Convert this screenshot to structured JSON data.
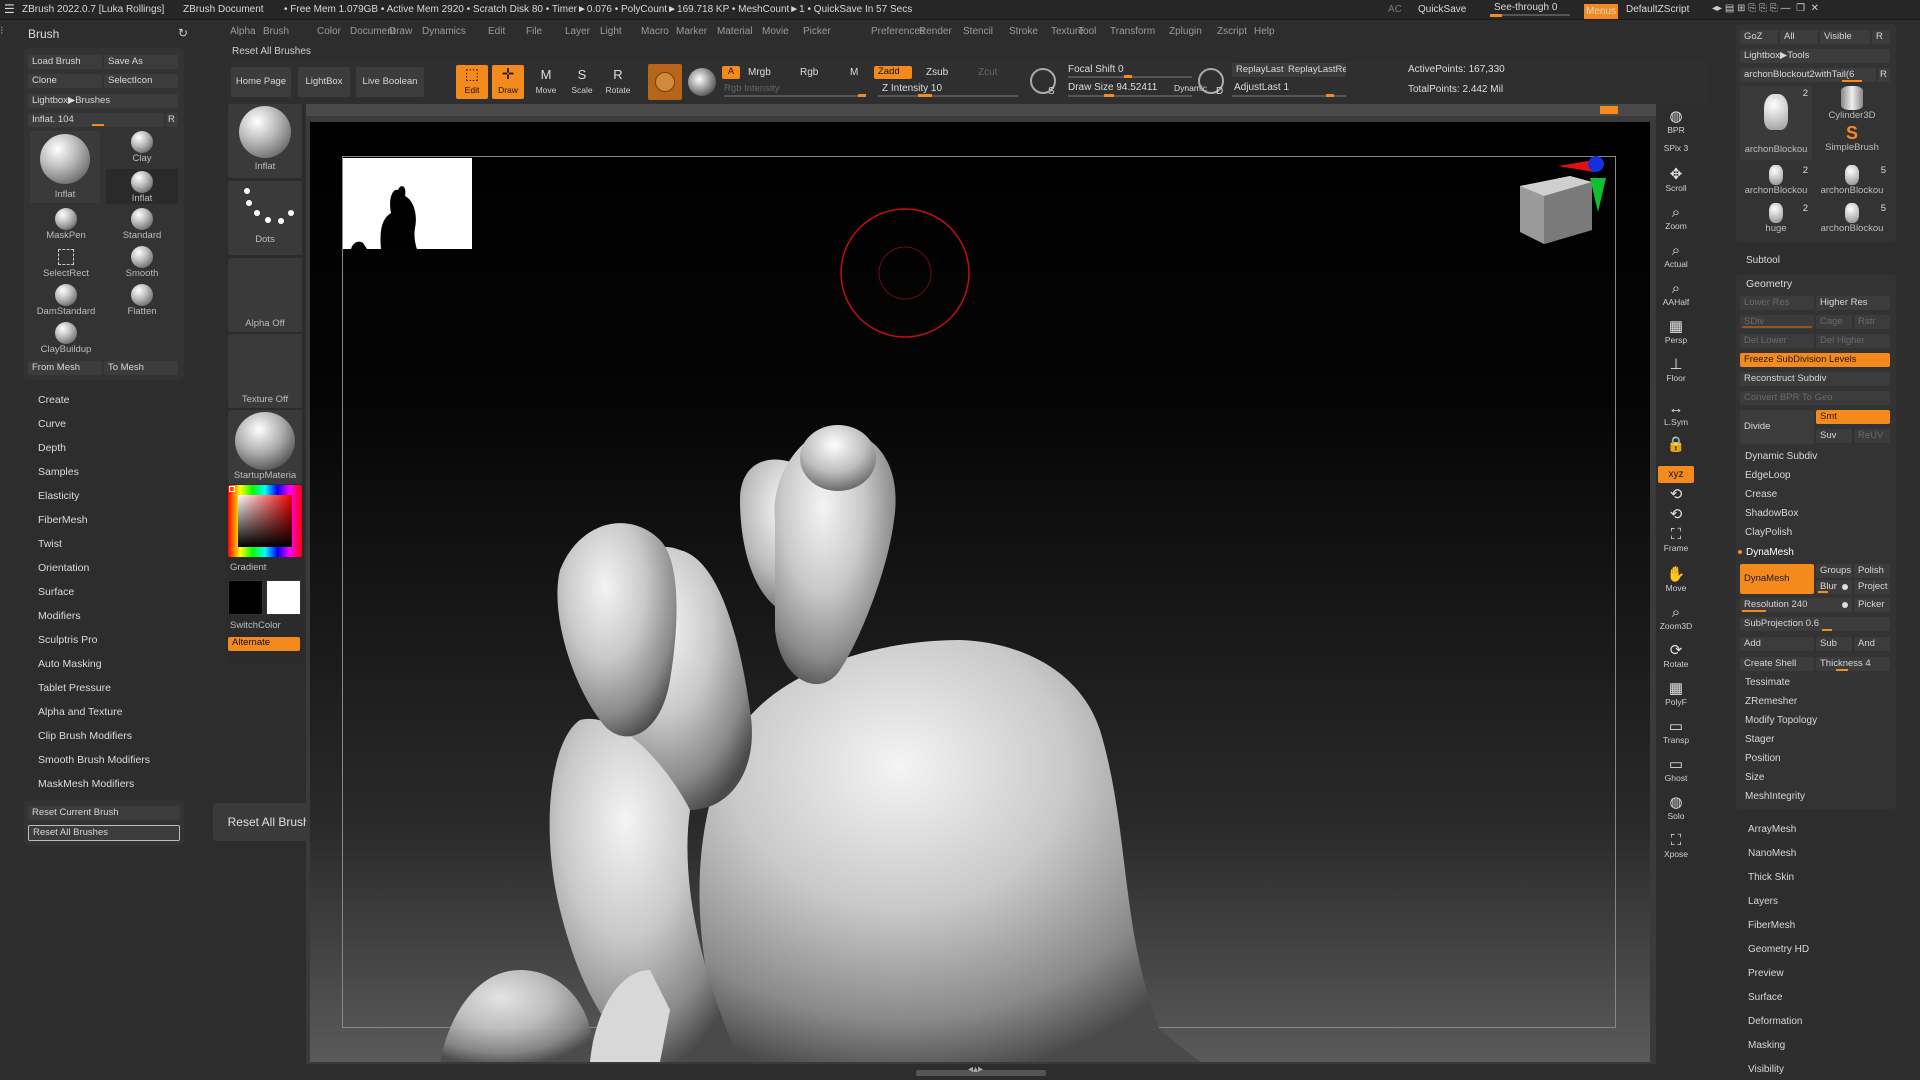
{
  "titlebar": {
    "app": "ZBrush 2022.0.7 [Luka Rollings]",
    "doc": "ZBrush Document",
    "stats": "• Free Mem 1.079GB • Active Mem 2920 • Scratch Disk 80 • Timer►0.076 • PolyCount►169.718 KP • MeshCount►1 • QuickSave In 57 Secs",
    "ac": "AC",
    "quicksave": "QuickSave",
    "seethrough": "See-through 0",
    "menus": "Menus",
    "script": "DefaultZScript"
  },
  "menubar": [
    "Alpha",
    "Brush",
    "Color",
    "Document",
    "Draw",
    "Dynamics",
    "Edit",
    "File",
    "Layer",
    "Light",
    "Macro",
    "Marker",
    "Material",
    "Movie",
    "Picker",
    "Preferences",
    "Render",
    "Stencil",
    "Stroke",
    "Texture",
    "Tool",
    "Transform",
    "Zplugin",
    "Zscript",
    "Help"
  ],
  "tooltip_top": "Reset All Brushes",
  "toolbar": {
    "home": "Home Page",
    "lightbox": "LightBox",
    "liveboolean": "Live Boolean",
    "edit": "Edit",
    "draw": "Draw",
    "move": "Move",
    "scale": "Scale",
    "rotate": "Rotate",
    "a": "A",
    "mrgb": "Mrgb",
    "rgb": "Rgb",
    "m": "M",
    "rgb_intensity": "Rgb Intensity",
    "zadd": "Zadd",
    "zsub": "Zsub",
    "zcut": "Zcut",
    "z_intensity": "Z Intensity 10",
    "focal_shift": "Focal Shift 0",
    "draw_size": "Draw Size 94.52411",
    "dynamic": "Dynamic",
    "s": "S",
    "d": "D",
    "replaylast": "ReplayLast",
    "replaylastrel": "ReplayLastRel",
    "adjustlast": "AdjustLast 1",
    "active_points": "ActivePoints: 167,330",
    "total_points": "TotalPoints: 2.442 Mil"
  },
  "brush_panel": {
    "title": "Brush",
    "load": "Load Brush",
    "saveas": "Save As",
    "clone": "Clone",
    "selecticon": "SelectIcon",
    "lightbox": "Lightbox▶Brushes",
    "inflat": "Inflat. 104",
    "r": "R",
    "cells": [
      "Inflat",
      "Clay",
      "Inflat",
      "MaskPen",
      "Standard",
      "SelectRect",
      "Smooth",
      "DamStandard",
      "Flatten",
      "ClayBuildup"
    ],
    "from_mesh": "From Mesh",
    "to_mesh": "To Mesh"
  },
  "brush_sections": [
    "Create",
    "Curve",
    "Depth",
    "Samples",
    "Elasticity",
    "FiberMesh",
    "Twist",
    "Orientation",
    "Surface",
    "Modifiers",
    "Sculptris Pro",
    "Auto Masking",
    "Tablet Pressure",
    "Alpha and Texture",
    "Clip Brush Modifiers",
    "Smooth Brush Modifiers",
    "MaskMesh Modifiers"
  ],
  "reset": {
    "current": "Reset Current Brush",
    "all": "Reset All Brushes",
    "tooltip": "Reset All Brushes"
  },
  "left_shelf": {
    "brush": "Inflat",
    "stroke": "Dots",
    "alpha": "Alpha Off",
    "texture": "Texture Off",
    "material": "StartupMateria",
    "gradient": "Gradient",
    "switchcolor": "SwitchColor",
    "alternate": "Alternate"
  },
  "right_toolbar": [
    {
      "glyph": "◍",
      "label": "BPR"
    },
    {
      "glyph": "",
      "label": "SPix 3"
    },
    {
      "glyph": "✥",
      "label": "Scroll"
    },
    {
      "glyph": "⌕",
      "label": "Zoom"
    },
    {
      "glyph": "⌕",
      "label": "Actual"
    },
    {
      "glyph": "⌕",
      "label": "AAHalf"
    },
    {
      "glyph": "▦",
      "label": "Persp"
    },
    {
      "glyph": "⊥",
      "label": "Floor"
    },
    {
      "glyph": "↔",
      "label": "L.Sym"
    },
    {
      "glyph": "🔒",
      "label": ""
    },
    {
      "glyph": "xyz",
      "label": ""
    },
    {
      "glyph": "⟲",
      "label": ""
    },
    {
      "glyph": "⟲",
      "label": ""
    },
    {
      "glyph": "⛶",
      "label": "Frame"
    },
    {
      "glyph": "✋",
      "label": "Move"
    },
    {
      "glyph": "⌕",
      "label": "Zoom3D"
    },
    {
      "glyph": "⟳",
      "label": "Rotate"
    },
    {
      "glyph": "▦",
      "label": "PolyF"
    },
    {
      "glyph": "▭",
      "label": "Transp"
    },
    {
      "glyph": "▭",
      "label": "Ghost"
    },
    {
      "glyph": "◍",
      "label": "Solo"
    },
    {
      "glyph": "⛶",
      "label": "Xpose"
    }
  ],
  "tool_panel": {
    "goz": "GoZ",
    "all": "All",
    "visible": "Visible",
    "r": "R",
    "lightbox": "Lightbox▶Tools",
    "current_tool": "archonBlockout2withTail(6",
    "tools": [
      {
        "label": "archonBlockou",
        "count": "2"
      },
      {
        "label": "Cylinder3D",
        "count": ""
      },
      {
        "label": "SimpleBrush",
        "count": ""
      },
      {
        "label": "archonBlockou",
        "count": "2"
      },
      {
        "label": "archonBlockou",
        "count": "5"
      },
      {
        "label": "huge",
        "count": "2"
      },
      {
        "label": "archonBlockou",
        "count": "5"
      }
    ]
  },
  "subtool": "Subtool",
  "geometry": {
    "title": "Geometry",
    "lower_res": "Lower Res",
    "higher_res": "Higher Res",
    "sdiv": "SDiv",
    "cage": "Cage",
    "rstr": "Rstr",
    "del_lower": "Del Lower",
    "del_higher": "Del Higher",
    "freeze": "Freeze SubDivision Levels",
    "reconstruct": "Reconstruct Subdiv",
    "convert_bpr": "Convert BPR To Geo",
    "divide": "Divide",
    "smt": "Smt",
    "suv": "Suv",
    "reuv": "ReUV",
    "items": [
      "Dynamic Subdiv",
      "EdgeLoop",
      "Crease",
      "ShadowBox",
      "ClayPolish"
    ],
    "dynamesh_title": "DynaMesh",
    "dynamesh_btn": "DynaMesh",
    "groups": "Groups",
    "polish": "Polish",
    "blur": "Blur",
    "project": "Project",
    "resolution": "Resolution 240",
    "picker": "Picker",
    "subprojection": "SubProjection 0.6",
    "add": "Add",
    "sub": "Sub",
    "and": "And",
    "create_shell": "Create Shell",
    "thickness": "Thickness 4",
    "items2": [
      "Tessimate",
      "ZRemesher",
      "Modify Topology",
      "Stager",
      "Position",
      "Size",
      "MeshIntegrity"
    ]
  },
  "tool_sections": [
    "ArrayMesh",
    "NanoMesh",
    "Thick Skin",
    "Layers",
    "FiberMesh",
    "Geometry HD",
    "Preview",
    "Surface",
    "Deformation",
    "Masking",
    "Visibility"
  ],
  "colors": {
    "accent": "#f58a1c",
    "panel": "#333333",
    "bg": "#2d2d2d"
  }
}
